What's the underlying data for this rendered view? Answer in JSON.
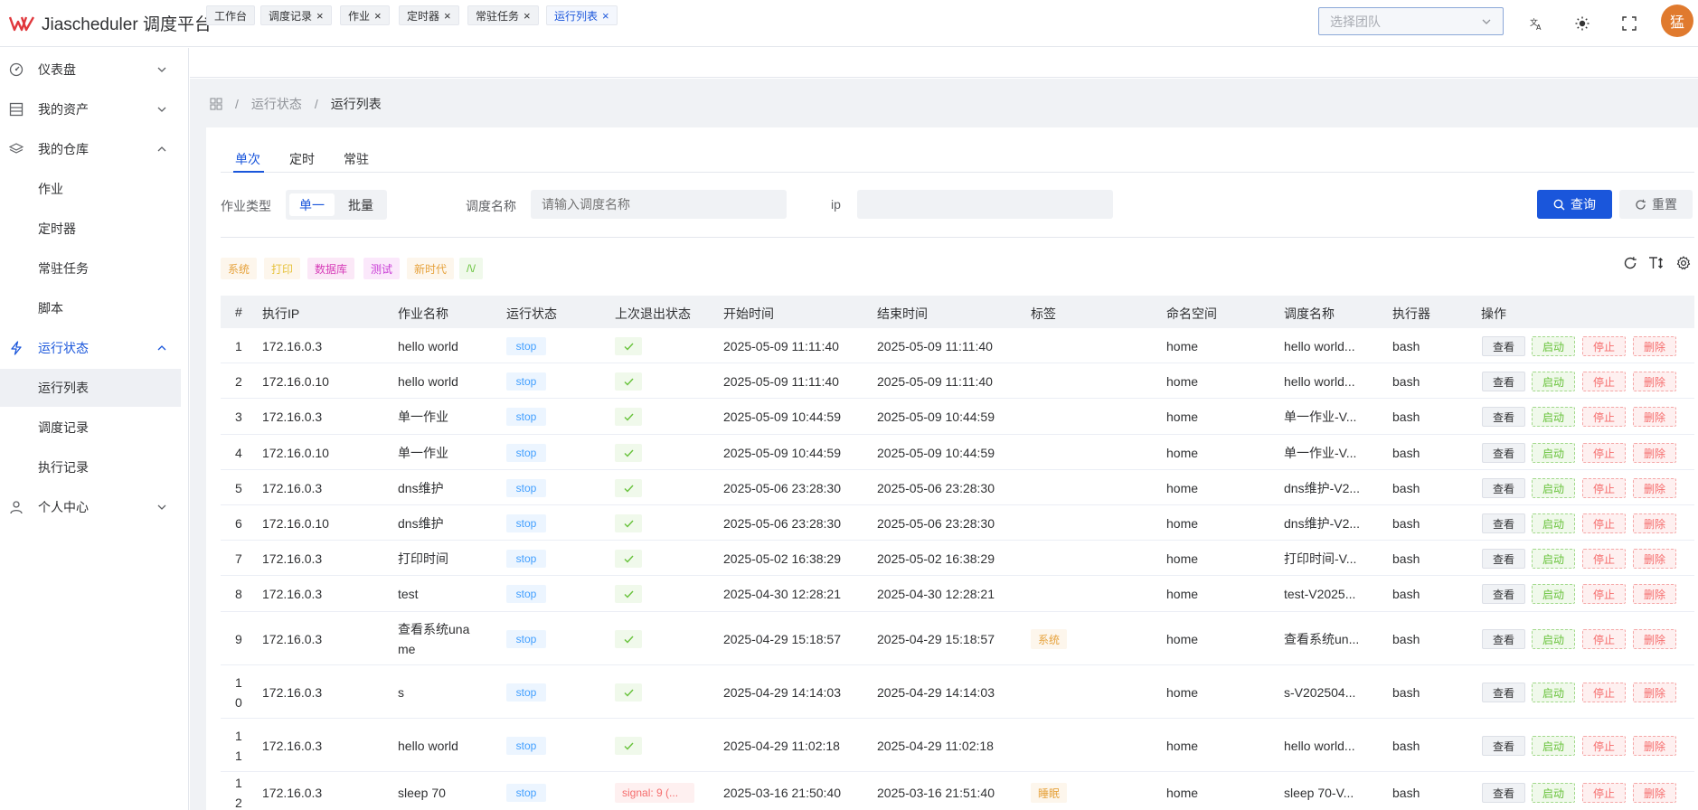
{
  "app": {
    "title": "Jiascheduler 调度平台",
    "brand_color": "#e0373c",
    "accent": "#1a56db"
  },
  "header": {
    "team_select_placeholder": "选择团队",
    "translate_icon": "translate-icon",
    "theme_icon": "sun-icon",
    "fullscreen_icon": "fullscreen-icon",
    "avatar_text": "猛"
  },
  "sidebar": {
    "dashboard": "仪表盘",
    "assets": "我的资产",
    "repo": "我的仓库",
    "repo_items": [
      "作业",
      "定时器",
      "常驻任务",
      "脚本"
    ],
    "runtime": "运行状态",
    "runtime_items": [
      "运行列表",
      "调度记录",
      "执行记录"
    ],
    "personal": "个人中心"
  },
  "tabs": [
    {
      "label": "工作台",
      "closable": false
    },
    {
      "label": "调度记录",
      "closable": true
    },
    {
      "label": "作业",
      "closable": true
    },
    {
      "label": "定时器",
      "closable": true
    },
    {
      "label": "常驻任务",
      "closable": true
    },
    {
      "label": "运行列表",
      "closable": true,
      "active": true
    }
  ],
  "breadcrumb": {
    "home_icon": "grid-icon",
    "level1": "运行状态",
    "level2": "运行列表"
  },
  "inner_tabs": [
    "单次",
    "定时",
    "常驻"
  ],
  "filters": {
    "job_type_label": "作业类型",
    "job_type_options": [
      "单一",
      "批量"
    ],
    "schedule_name_label": "调度名称",
    "schedule_name_placeholder": "请输入调度名称",
    "ip_label": "ip",
    "ip_value": "",
    "query_button": "查询",
    "reset_button": "重置"
  },
  "chips": [
    {
      "label": "系统",
      "bg": "#fdf6ec",
      "color": "#e6a23c"
    },
    {
      "label": "打印",
      "bg": "#fdf6ec",
      "color": "#e6c23c"
    },
    {
      "label": "数据库",
      "bg": "#fbe8f7",
      "color": "#d63cb8"
    },
    {
      "label": "测试",
      "bg": "#fbe8fb",
      "color": "#c93cd6"
    },
    {
      "label": "新时代",
      "bg": "#fdf6ec",
      "color": "#e6a23c"
    },
    {
      "label": "/\\/",
      "bg": "#f0f9eb",
      "color": "#67c23a"
    }
  ],
  "table": {
    "headers": [
      "#",
      "执行IP",
      "作业名称",
      "运行状态",
      "上次退出状态",
      "开始时间",
      "结束时间",
      "标签",
      "命名空间",
      "调度名称",
      "执行器",
      "操作"
    ],
    "ops": {
      "view": "查看",
      "start": "启动",
      "stop": "停止",
      "delete": "删除"
    },
    "rows": [
      {
        "no": "1",
        "ip": "172.16.0.3",
        "job": "hello world",
        "status": "stop",
        "exit": "ok",
        "start": "2025-05-09 11:11:40",
        "end": "2025-05-09 11:11:40",
        "tag": "",
        "ns": "home",
        "schedule": "hello world...",
        "executor": "bash"
      },
      {
        "no": "2",
        "ip": "172.16.0.10",
        "job": "hello world",
        "status": "stop",
        "exit": "ok",
        "start": "2025-05-09 11:11:40",
        "end": "2025-05-09 11:11:40",
        "tag": "",
        "ns": "home",
        "schedule": "hello world...",
        "executor": "bash"
      },
      {
        "no": "3",
        "ip": "172.16.0.3",
        "job": "单一作业",
        "status": "stop",
        "exit": "ok",
        "start": "2025-05-09 10:44:59",
        "end": "2025-05-09 10:44:59",
        "tag": "",
        "ns": "home",
        "schedule": "单一作业-V...",
        "executor": "bash"
      },
      {
        "no": "4",
        "ip": "172.16.0.10",
        "job": "单一作业",
        "status": "stop",
        "exit": "ok",
        "start": "2025-05-09 10:44:59",
        "end": "2025-05-09 10:44:59",
        "tag": "",
        "ns": "home",
        "schedule": "单一作业-V...",
        "executor": "bash"
      },
      {
        "no": "5",
        "ip": "172.16.0.3",
        "job": "dns维护",
        "status": "stop",
        "exit": "ok",
        "start": "2025-05-06 23:28:30",
        "end": "2025-05-06 23:28:30",
        "tag": "",
        "ns": "home",
        "schedule": "dns维护-V2...",
        "executor": "bash"
      },
      {
        "no": "6",
        "ip": "172.16.0.10",
        "job": "dns维护",
        "status": "stop",
        "exit": "ok",
        "start": "2025-05-06 23:28:30",
        "end": "2025-05-06 23:28:30",
        "tag": "",
        "ns": "home",
        "schedule": "dns维护-V2...",
        "executor": "bash"
      },
      {
        "no": "7",
        "ip": "172.16.0.3",
        "job": "打印时间",
        "status": "stop",
        "exit": "ok",
        "start": "2025-05-02 16:38:29",
        "end": "2025-05-02 16:38:29",
        "tag": "",
        "ns": "home",
        "schedule": "打印时间-V...",
        "executor": "bash"
      },
      {
        "no": "8",
        "ip": "172.16.0.3",
        "job": "test",
        "status": "stop",
        "exit": "ok",
        "start": "2025-04-30 12:28:21",
        "end": "2025-04-30 12:28:21",
        "tag": "",
        "ns": "home",
        "schedule": "test-V2025...",
        "executor": "bash"
      },
      {
        "no": "9",
        "ip": "172.16.0.3",
        "job": "查看系统una me",
        "job_lines": [
          "查看系统una",
          "me"
        ],
        "status": "stop",
        "exit": "ok",
        "start": "2025-04-29 15:18:57",
        "end": "2025-04-29 15:18:57",
        "tag": "系统",
        "tag_bg": "#fdf6ec",
        "tag_color": "#e6a23c",
        "ns": "home",
        "schedule": "查看系统un...",
        "executor": "bash"
      },
      {
        "no": "10",
        "no_lines": [
          "1",
          "0"
        ],
        "ip": "172.16.0.3",
        "job": "s",
        "status": "stop",
        "exit": "ok",
        "start": "2025-04-29 14:14:03",
        "end": "2025-04-29 14:14:03",
        "tag": "",
        "ns": "home",
        "schedule": "s-V202504...",
        "executor": "bash"
      },
      {
        "no": "11",
        "no_lines": [
          "1",
          "1"
        ],
        "ip": "172.16.0.3",
        "job": "hello world",
        "status": "stop",
        "exit": "ok",
        "start": "2025-04-29 11:02:18",
        "end": "2025-04-29 11:02:18",
        "tag": "",
        "ns": "home",
        "schedule": "hello world...",
        "executor": "bash"
      },
      {
        "no": "12",
        "no_lines": [
          "1",
          "2"
        ],
        "ip": "172.16.0.3",
        "job": "sleep 70",
        "status": "stop",
        "exit": "signal: 9 (...",
        "start": "2025-03-16 21:50:40",
        "end": "2025-03-16 21:51:40",
        "tag": "睡眠",
        "tag_bg": "#fdf6ec",
        "tag_color": "#e6a23c",
        "ns": "home",
        "schedule": "sleep 70-V...",
        "executor": "bash"
      }
    ]
  }
}
